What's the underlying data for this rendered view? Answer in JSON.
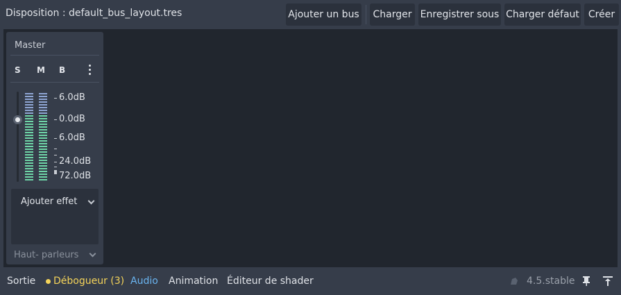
{
  "toolbar": {
    "layout_label": "Disposition : default_bus_layout.tres",
    "add_bus": "Ajouter un bus",
    "load": "Charger",
    "save_as": "Enregistrer sous",
    "load_default": "Charger défaut",
    "create": "Créer"
  },
  "bus": {
    "name": "Master",
    "solo": "S",
    "mute": "M",
    "bypass": "B",
    "volume_db": 0,
    "db_scale": [
      "6.0dB",
      "0.0dB",
      "6.0dB",
      "24.0dB",
      "72.0dB"
    ],
    "add_effect": "Ajouter effet",
    "output": "Haut- parleurs"
  },
  "bottombar": {
    "output": "Sortie",
    "debugger": "Débogueur (3)",
    "audio": "Audio",
    "animation": "Animation",
    "shader_editor": "Éditeur de shader",
    "version": "4.5.stable"
  },
  "colors": {
    "panel": "#363d4a",
    "background": "#21262e",
    "meter_green": "#6fd6a8",
    "meter_blue": "#8fa6d4",
    "accent_active": "#6ab4f0",
    "warning": "#f5d45a"
  }
}
